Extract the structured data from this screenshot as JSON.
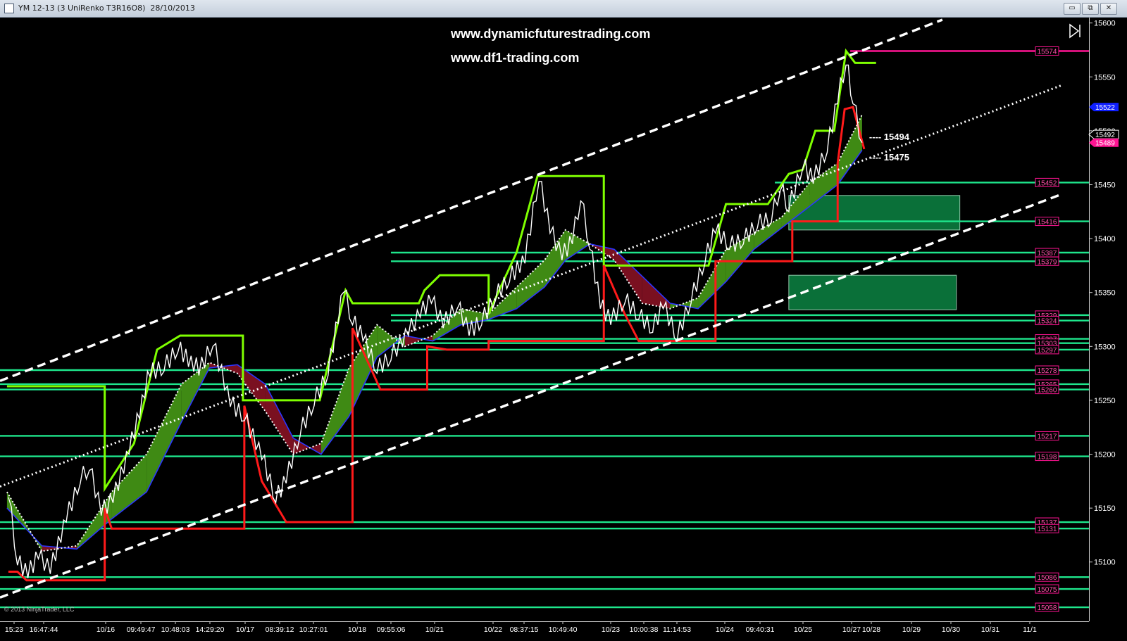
{
  "window": {
    "title": "YM 12-13 (3 UniRenko T3R16O8)  28/10/2013",
    "buttons": {
      "minimize": "▭",
      "restore": "⧉",
      "close": "✕"
    }
  },
  "watermark": {
    "line1": "www.dynamicfuturestrading.com",
    "line2": "www.df1-trading.com"
  },
  "copyright": "© 2013 NinjaTrader, LLC",
  "colors": {
    "background": "#000000",
    "price": "#ffffff",
    "upper_band": "#7fff00",
    "lower_band": "#ff1a1a",
    "support_lines": "#1ee68c",
    "resistance_line": "#ff1493",
    "channel": "#ffffff",
    "ribbon_up": "#3f8a14",
    "ribbon_down": "#7a1020",
    "zone": "#0b7a3e",
    "price_marker_current": "#1020ff",
    "price_marker_last": "#ff1493"
  },
  "chart_data": {
    "type": "line",
    "instrument": "YM 12-13",
    "bar_type": "3 UniRenko T3R16O8",
    "date": "28/10/2013",
    "ylim": [
      15045,
      15605
    ],
    "y_ticks": [
      15100,
      15150,
      15200,
      15250,
      15300,
      15350,
      15400,
      15450,
      15500,
      15550,
      15600
    ],
    "x_tick_labels": [
      "15:23",
      "16:47:44",
      "10/16",
      "09:49:47",
      "10:48:03",
      "14:29:20",
      "10/17",
      "08:39:12",
      "10:27:01",
      "10/18",
      "09:55:06",
      "10/21",
      "10/22",
      "08:37:15",
      "10:49:40",
      "10/23",
      "10:00:38",
      "11:14:53",
      "10/24",
      "09:40:31",
      "10/25",
      "10/27",
      "10/28",
      "10/29",
      "10/30",
      "10/31",
      "11/1"
    ],
    "levels": [
      {
        "value": 15574,
        "kind": "resistance"
      },
      {
        "value": 15452,
        "kind": "support"
      },
      {
        "value": 15416,
        "kind": "support"
      },
      {
        "value": 15387,
        "kind": "support"
      },
      {
        "value": 15379,
        "kind": "support"
      },
      {
        "value": 15329,
        "kind": "support"
      },
      {
        "value": 15324,
        "kind": "support"
      },
      {
        "value": 15307,
        "kind": "support"
      },
      {
        "value": 15303,
        "kind": "support"
      },
      {
        "value": 15297,
        "kind": "support"
      },
      {
        "value": 15278,
        "kind": "support"
      },
      {
        "value": 15265,
        "kind": "support"
      },
      {
        "value": 15260,
        "kind": "support"
      },
      {
        "value": 15217,
        "kind": "support"
      },
      {
        "value": 15198,
        "kind": "support"
      },
      {
        "value": 15137,
        "kind": "support"
      },
      {
        "value": 15131,
        "kind": "support"
      },
      {
        "value": 15086,
        "kind": "support"
      },
      {
        "value": 15075,
        "kind": "support"
      },
      {
        "value": 15058,
        "kind": "support"
      }
    ],
    "annotations": [
      {
        "text": "---- 15494",
        "value": 15494
      },
      {
        "text": "---- 15475",
        "value": 15475
      }
    ],
    "price_markers": [
      {
        "text": "15522",
        "value": 15522,
        "kind": "current"
      },
      {
        "text": "15492",
        "value": 15492,
        "kind": "current"
      },
      {
        "text": "15489",
        "value": 15489,
        "kind": "last"
      }
    ],
    "channel": {
      "upper": [
        {
          "bar": 0,
          "price": 15268
        },
        {
          "bar": 1350,
          "price": 15603
        }
      ],
      "middle": [
        {
          "bar": 0,
          "price": 15170
        },
        {
          "bar": 1520,
          "price": 15542
        }
      ],
      "lower": [
        {
          "bar": 0,
          "price": 15067
        },
        {
          "bar": 1520,
          "price": 15441
        }
      ]
    },
    "zones": [
      {
        "bar_start": 1130,
        "bar_end": 1375,
        "price_top": 15440,
        "price_bottom": 15408
      },
      {
        "bar_start": 1130,
        "bar_end": 1370,
        "price_top": 15366,
        "price_bottom": 15334
      }
    ],
    "price_anchors": [
      {
        "bar": 12,
        "price": 15165
      },
      {
        "bar": 25,
        "price": 15102
      },
      {
        "bar": 40,
        "price": 15090
      },
      {
        "bar": 55,
        "price": 15108
      },
      {
        "bar": 72,
        "price": 15094
      },
      {
        "bar": 95,
        "price": 15142
      },
      {
        "bar": 115,
        "price": 15178
      },
      {
        "bar": 128,
        "price": 15190
      },
      {
        "bar": 145,
        "price": 15148
      },
      {
        "bar": 162,
        "price": 15160
      },
      {
        "bar": 185,
        "price": 15205
      },
      {
        "bar": 215,
        "price": 15277
      },
      {
        "bar": 235,
        "price": 15282
      },
      {
        "bar": 255,
        "price": 15300
      },
      {
        "bar": 285,
        "price": 15278
      },
      {
        "bar": 305,
        "price": 15305
      },
      {
        "bar": 330,
        "price": 15249
      },
      {
        "bar": 350,
        "price": 15236
      },
      {
        "bar": 375,
        "price": 15200
      },
      {
        "bar": 395,
        "price": 15160
      },
      {
        "bar": 410,
        "price": 15178
      },
      {
        "bar": 430,
        "price": 15222
      },
      {
        "bar": 450,
        "price": 15250
      },
      {
        "bar": 470,
        "price": 15278
      },
      {
        "bar": 492,
        "price": 15355
      },
      {
        "bar": 505,
        "price": 15325
      },
      {
        "bar": 520,
        "price": 15310
      },
      {
        "bar": 540,
        "price": 15280
      },
      {
        "bar": 560,
        "price": 15292
      },
      {
        "bar": 585,
        "price": 15315
      },
      {
        "bar": 602,
        "price": 15332
      },
      {
        "bar": 618,
        "price": 15345
      },
      {
        "bar": 635,
        "price": 15322
      },
      {
        "bar": 655,
        "price": 15340
      },
      {
        "bar": 672,
        "price": 15315
      },
      {
        "bar": 690,
        "price": 15325
      },
      {
        "bar": 710,
        "price": 15348
      },
      {
        "bar": 730,
        "price": 15365
      },
      {
        "bar": 752,
        "price": 15382
      },
      {
        "bar": 772,
        "price": 15458
      },
      {
        "bar": 788,
        "price": 15410
      },
      {
        "bar": 805,
        "price": 15385
      },
      {
        "bar": 820,
        "price": 15400
      },
      {
        "bar": 832,
        "price": 15440
      },
      {
        "bar": 845,
        "price": 15395
      },
      {
        "bar": 860,
        "price": 15340
      },
      {
        "bar": 875,
        "price": 15325
      },
      {
        "bar": 895,
        "price": 15345
      },
      {
        "bar": 915,
        "price": 15330
      },
      {
        "bar": 935,
        "price": 15318
      },
      {
        "bar": 950,
        "price": 15340
      },
      {
        "bar": 970,
        "price": 15310
      },
      {
        "bar": 990,
        "price": 15345
      },
      {
        "bar": 1010,
        "price": 15382
      },
      {
        "bar": 1025,
        "price": 15410
      },
      {
        "bar": 1045,
        "price": 15395
      },
      {
        "bar": 1065,
        "price": 15400
      },
      {
        "bar": 1085,
        "price": 15415
      },
      {
        "bar": 1105,
        "price": 15420
      },
      {
        "bar": 1118,
        "price": 15450
      },
      {
        "bar": 1130,
        "price": 15430
      },
      {
        "bar": 1150,
        "price": 15470
      },
      {
        "bar": 1165,
        "price": 15456
      },
      {
        "bar": 1185,
        "price": 15485
      },
      {
        "bar": 1200,
        "price": 15530
      },
      {
        "bar": 1212,
        "price": 15566
      },
      {
        "bar": 1222,
        "price": 15530
      },
      {
        "bar": 1235,
        "price": 15489
      }
    ],
    "upper_band": [
      {
        "bar": 10,
        "price": 15263
      },
      {
        "bar": 150,
        "price": 15263
      },
      {
        "bar": 150,
        "price": 15168
      },
      {
        "bar": 192,
        "price": 15210
      },
      {
        "bar": 225,
        "price": 15297
      },
      {
        "bar": 258,
        "price": 15310
      },
      {
        "bar": 348,
        "price": 15310
      },
      {
        "bar": 348,
        "price": 15250
      },
      {
        "bar": 458,
        "price": 15250
      },
      {
        "bar": 495,
        "price": 15352
      },
      {
        "bar": 505,
        "price": 15340
      },
      {
        "bar": 600,
        "price": 15340
      },
      {
        "bar": 608,
        "price": 15352
      },
      {
        "bar": 630,
        "price": 15366
      },
      {
        "bar": 700,
        "price": 15366
      },
      {
        "bar": 700,
        "price": 15330
      },
      {
        "bar": 715,
        "price": 15352
      },
      {
        "bar": 740,
        "price": 15387
      },
      {
        "bar": 770,
        "price": 15458
      },
      {
        "bar": 865,
        "price": 15458
      },
      {
        "bar": 865,
        "price": 15375
      },
      {
        "bar": 1015,
        "price": 15375
      },
      {
        "bar": 1040,
        "price": 15432
      },
      {
        "bar": 1100,
        "price": 15432
      },
      {
        "bar": 1130,
        "price": 15460
      },
      {
        "bar": 1150,
        "price": 15464
      },
      {
        "bar": 1168,
        "price": 15500
      },
      {
        "bar": 1195,
        "price": 15500
      },
      {
        "bar": 1212,
        "price": 15574
      },
      {
        "bar": 1225,
        "price": 15563
      },
      {
        "bar": 1255,
        "price": 15563
      }
    ],
    "lower_band": [
      {
        "bar": 12,
        "price": 15091
      },
      {
        "bar": 25,
        "price": 15091
      },
      {
        "bar": 38,
        "price": 15083
      },
      {
        "bar": 150,
        "price": 15083
      },
      {
        "bar": 150,
        "price": 15150
      },
      {
        "bar": 160,
        "price": 15131
      },
      {
        "bar": 350,
        "price": 15131
      },
      {
        "bar": 350,
        "price": 15245
      },
      {
        "bar": 375,
        "price": 15175
      },
      {
        "bar": 410,
        "price": 15137
      },
      {
        "bar": 505,
        "price": 15137
      },
      {
        "bar": 505,
        "price": 15317
      },
      {
        "bar": 545,
        "price": 15260
      },
      {
        "bar": 612,
        "price": 15260
      },
      {
        "bar": 612,
        "price": 15300
      },
      {
        "bar": 640,
        "price": 15297
      },
      {
        "bar": 700,
        "price": 15297
      },
      {
        "bar": 700,
        "price": 15305
      },
      {
        "bar": 865,
        "price": 15305
      },
      {
        "bar": 865,
        "price": 15375
      },
      {
        "bar": 895,
        "price": 15330
      },
      {
        "bar": 915,
        "price": 15305
      },
      {
        "bar": 1025,
        "price": 15305
      },
      {
        "bar": 1025,
        "price": 15379
      },
      {
        "bar": 1135,
        "price": 15379
      },
      {
        "bar": 1135,
        "price": 15416
      },
      {
        "bar": 1200,
        "price": 15416
      },
      {
        "bar": 1200,
        "price": 15470
      },
      {
        "bar": 1210,
        "price": 15520
      },
      {
        "bar": 1222,
        "price": 15522
      },
      {
        "bar": 1238,
        "price": 15483
      }
    ],
    "ribbon": [
      {
        "bar": 10,
        "fast": 15165,
        "slow": 15150
      },
      {
        "bar": 60,
        "fast": 15110,
        "slow": 15115
      },
      {
        "bar": 110,
        "fast": 15115,
        "slow": 15112
      },
      {
        "bar": 160,
        "fast": 15165,
        "slow": 15140
      },
      {
        "bar": 210,
        "fast": 15200,
        "slow": 15165
      },
      {
        "bar": 260,
        "fast": 15265,
        "slow": 15230
      },
      {
        "bar": 300,
        "fast": 15285,
        "slow": 15280
      },
      {
        "bar": 340,
        "fast": 15275,
        "slow": 15283
      },
      {
        "bar": 380,
        "fast": 15240,
        "slow": 15265
      },
      {
        "bar": 420,
        "fast": 15200,
        "slow": 15215
      },
      {
        "bar": 460,
        "fast": 15210,
        "slow": 15200
      },
      {
        "bar": 500,
        "fast": 15280,
        "slow": 15235
      },
      {
        "bar": 540,
        "fast": 15320,
        "slow": 15290
      },
      {
        "bar": 580,
        "fast": 15300,
        "slow": 15310
      },
      {
        "bar": 620,
        "fast": 15310,
        "slow": 15305
      },
      {
        "bar": 660,
        "fast": 15335,
        "slow": 15320
      },
      {
        "bar": 700,
        "fast": 15330,
        "slow": 15325
      },
      {
        "bar": 740,
        "fast": 15355,
        "slow": 15335
      },
      {
        "bar": 780,
        "fast": 15380,
        "slow": 15355
      },
      {
        "bar": 810,
        "fast": 15408,
        "slow": 15380
      },
      {
        "bar": 845,
        "fast": 15395,
        "slow": 15395
      },
      {
        "bar": 880,
        "fast": 15380,
        "slow": 15390
      },
      {
        "bar": 920,
        "fast": 15340,
        "slow": 15365
      },
      {
        "bar": 960,
        "fast": 15335,
        "slow": 15340
      },
      {
        "bar": 1000,
        "fast": 15345,
        "slow": 15335
      },
      {
        "bar": 1040,
        "fast": 15390,
        "slow": 15360
      },
      {
        "bar": 1080,
        "fast": 15405,
        "slow": 15390
      },
      {
        "bar": 1120,
        "fast": 15420,
        "slow": 15410
      },
      {
        "bar": 1160,
        "fast": 15452,
        "slow": 15430
      },
      {
        "bar": 1200,
        "fast": 15470,
        "slow": 15450
      },
      {
        "bar": 1235,
        "fast": 15515,
        "slow": 15482
      }
    ]
  }
}
